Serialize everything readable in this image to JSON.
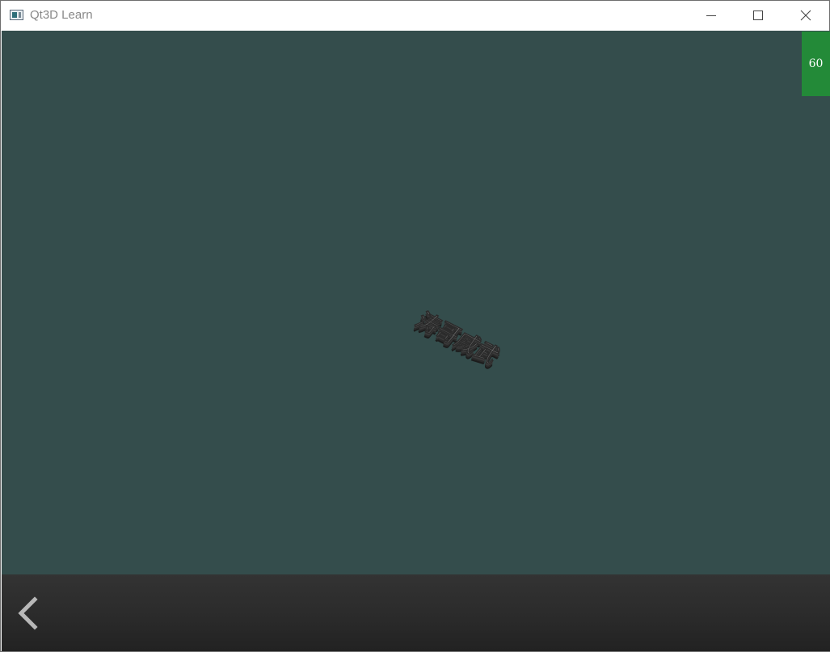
{
  "window": {
    "title": "Qt3D Learn",
    "icons": {
      "app": "app-window-icon",
      "minimize": "minimize-icon",
      "maximize": "maximize-icon",
      "close": "close-icon"
    }
  },
  "viewport": {
    "background_color": "#344d4c",
    "fps": "60",
    "fps_badge_color": "#238a38",
    "scene_text": "涛哥威武"
  },
  "bottom_bar": {
    "back_icon": "chevron-left-icon"
  }
}
